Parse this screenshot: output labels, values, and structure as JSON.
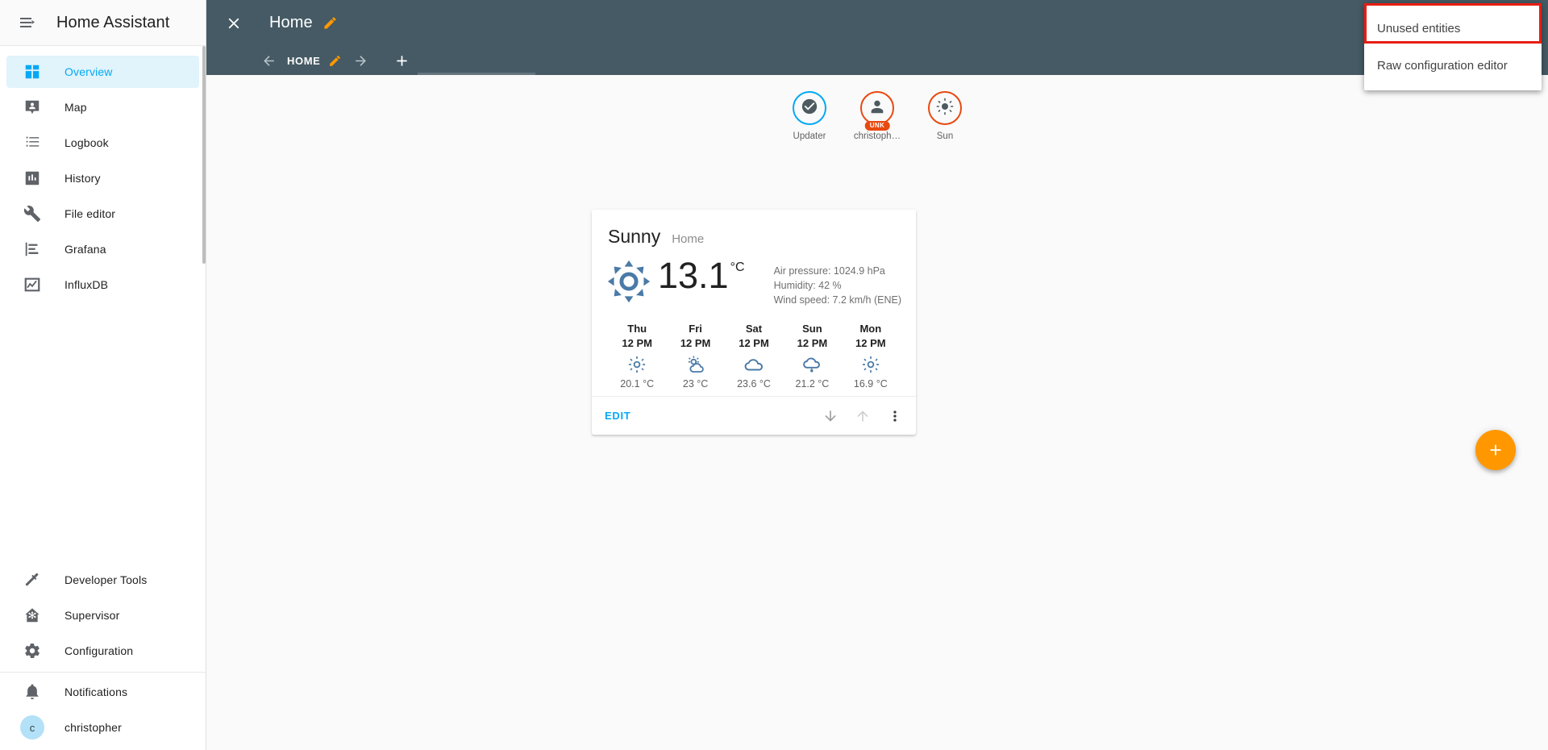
{
  "sidebar": {
    "title": "Home Assistant",
    "burger_icon": "menu-collapse-icon",
    "items": [
      {
        "label": "Overview",
        "icon": "view-dashboard-icon",
        "active": true
      },
      {
        "label": "Map",
        "icon": "map-marker-account-icon",
        "active": false
      },
      {
        "label": "Logbook",
        "icon": "format-list-bulleted-icon",
        "active": false
      },
      {
        "label": "History",
        "icon": "chart-box-icon",
        "active": false
      },
      {
        "label": "File editor",
        "icon": "wrench-icon",
        "active": false
      },
      {
        "label": "Grafana",
        "icon": "chart-timeline-icon",
        "active": false
      },
      {
        "label": "InfluxDB",
        "icon": "chart-line-variant-icon",
        "active": false
      }
    ],
    "bottom_items": [
      {
        "label": "Developer Tools",
        "icon": "hammer-icon"
      },
      {
        "label": "Supervisor",
        "icon": "home-assistant-supervisor-icon"
      },
      {
        "label": "Configuration",
        "icon": "cog-icon"
      }
    ],
    "footer_items": [
      {
        "label": "Notifications",
        "icon": "bell-icon"
      }
    ],
    "user": {
      "label": "christopher",
      "initial": "c"
    }
  },
  "toolbar": {
    "close_icon": "close-icon",
    "title": "Home",
    "edit_icon": "pencil-icon",
    "accent_color": "#ff9800",
    "background_color": "#455a64"
  },
  "tabbar": {
    "prev_icon": "arrow-left-icon",
    "next_icon": "arrow-right-icon",
    "add_icon": "plus-icon",
    "tabs": [
      {
        "label": "HOME",
        "edit_icon": "pencil-icon",
        "active": true
      }
    ]
  },
  "menu": {
    "items": [
      {
        "label": "Unused entities",
        "highlighted": true
      },
      {
        "label": "Raw configuration editor",
        "highlighted": false
      }
    ],
    "highlight_color": "#e71d12"
  },
  "badges": [
    {
      "name": "Updater",
      "icon": "check-circle-icon",
      "ring_color": "#03a9f4",
      "sub_label": ""
    },
    {
      "name": "christoph…",
      "icon": "account-icon",
      "ring_color": "#e8490f",
      "sub_label": "UNK"
    },
    {
      "name": "Sun",
      "icon": "weather-sunny-icon",
      "ring_color": "#e8490f",
      "sub_label": ""
    }
  ],
  "weather_card": {
    "state": "Sunny",
    "location": "Home",
    "icon": "weather-sunny-icon",
    "temperature": "13.1",
    "temperature_unit": "°C",
    "attributes": [
      "Air pressure: 1024.9 hPa",
      "Humidity: 42 %",
      "Wind speed: 7.2 km/h (ENE)"
    ],
    "forecast": [
      {
        "day": "Thu",
        "time": "12 PM",
        "icon": "weather-sunny-icon",
        "temp": "20.1 °C"
      },
      {
        "day": "Fri",
        "time": "12 PM",
        "icon": "weather-partly-cloudy-icon",
        "temp": "23 °C"
      },
      {
        "day": "Sat",
        "time": "12 PM",
        "icon": "weather-cloudy-icon",
        "temp": "23.6 °C"
      },
      {
        "day": "Sun",
        "time": "12 PM",
        "icon": "weather-rainy-icon",
        "temp": "21.2 °C"
      },
      {
        "day": "Mon",
        "time": "12 PM",
        "icon": "weather-sunny-icon",
        "temp": "16.9 °C"
      }
    ],
    "footer": {
      "edit_label": "EDIT",
      "move_down_icon": "arrow-down-icon",
      "move_up_icon": "arrow-up-icon",
      "more_icon": "dots-vertical-icon"
    }
  },
  "fab": {
    "icon": "plus-icon",
    "color": "#ff9800"
  }
}
